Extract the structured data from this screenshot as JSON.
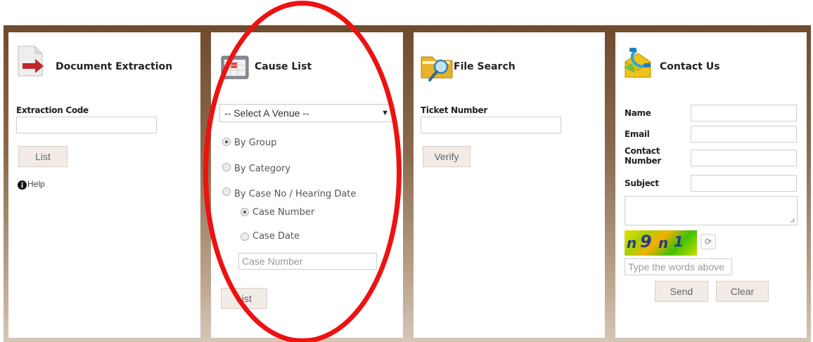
{
  "doc_extraction": {
    "title": "Document Extraction",
    "code_label": "Extraction Code",
    "code_value": "",
    "list_label": "List",
    "help_label": "Help",
    "icon": "document-arrow-icon"
  },
  "cause_list": {
    "title": "Cause List",
    "icon": "calendar-icon",
    "venue_select": "-- Select A Venue --",
    "radio_group": "By Group",
    "radio_category": "By Category",
    "radio_case": "By Case No / Hearing Date",
    "radio_case_number": "Case Number",
    "radio_case_date": "Case Date",
    "case_number_placeholder": "Case Number",
    "list_label": "List",
    "selected": "By Group",
    "selected_sub": "Case Number"
  },
  "file_search": {
    "title": "File Search",
    "icon": "folder-search-icon",
    "ticket_label": "Ticket Number",
    "ticket_value": "",
    "verify_label": "Verify"
  },
  "contact": {
    "title": "Contact Us",
    "icon": "phone-envelope-icon",
    "name_label": "Name",
    "email_label": "Email",
    "contact_label_1": "Contact",
    "contact_label_2": "Number",
    "subject_label": "Subject",
    "captcha_text": "n 9 n 1",
    "captcha_placeholder": "Type the words above",
    "send_label": "Send",
    "clear_label": "Clear"
  },
  "colors": {
    "frame_top": "#6f4a2e",
    "frame_bottom": "#d6c6b6",
    "highlight_oval": "#ee1111"
  }
}
